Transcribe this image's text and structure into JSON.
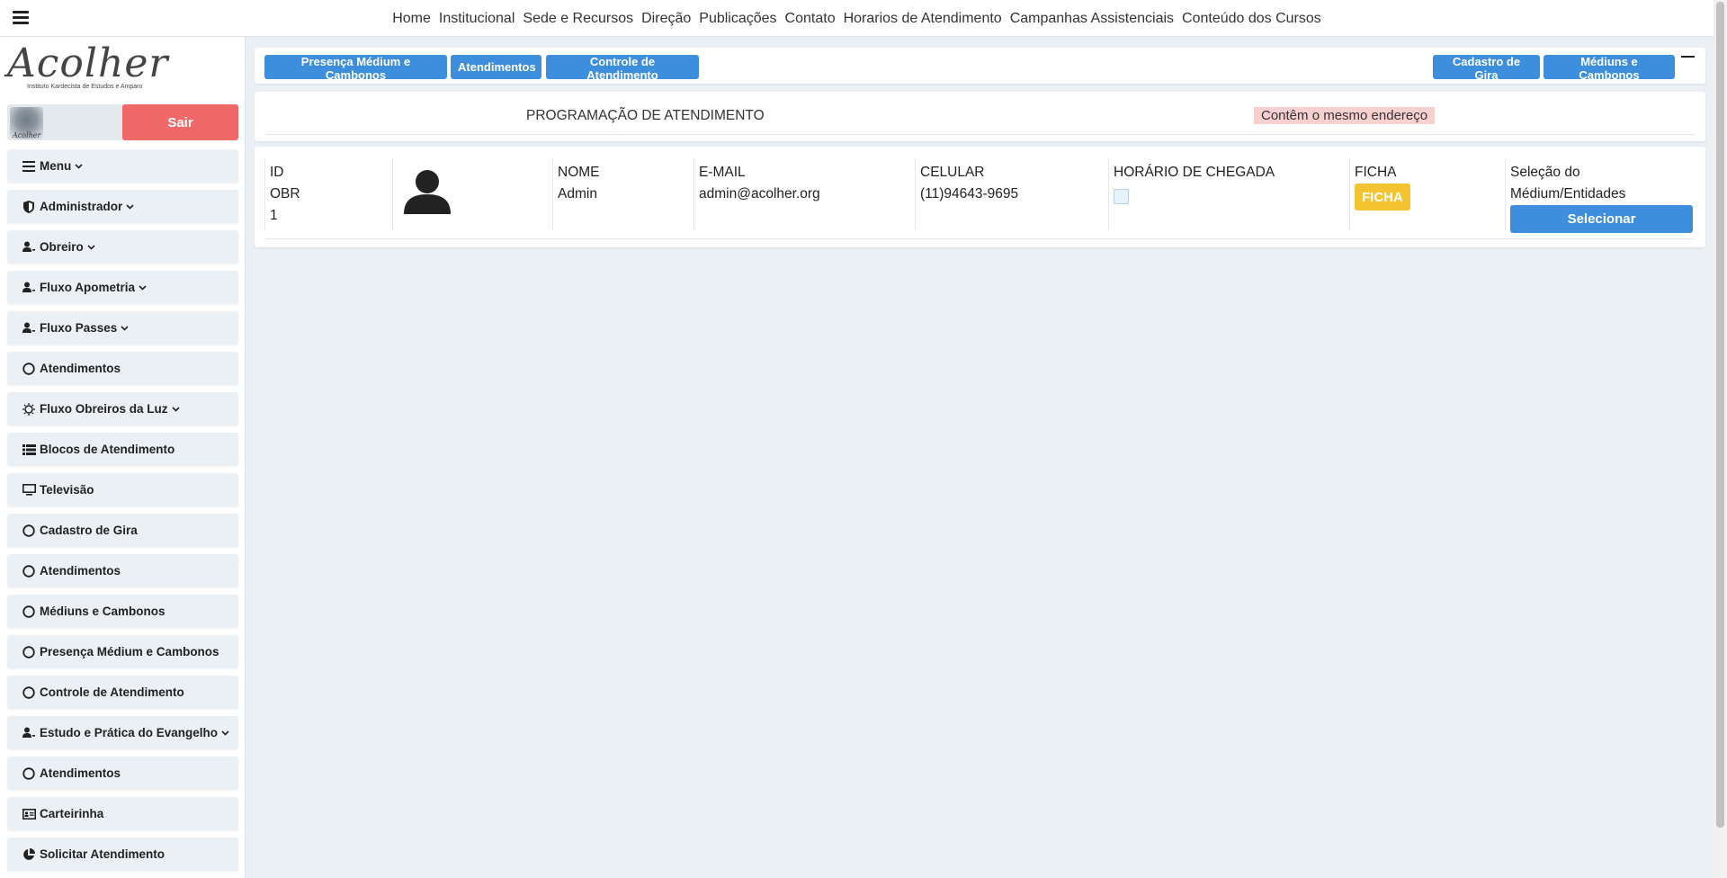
{
  "topnav": {
    "links": [
      "Home",
      "Institucional",
      "Sede e Recursos",
      "Direção",
      "Publicações",
      "Contato",
      "Horarios de Atendimento",
      "Campanhas Assistenciais",
      "Conteúdo dos Cursos"
    ]
  },
  "sidebar": {
    "logo_text": "Acolher",
    "logo_subtitle": "Instituto Kardecista de Estudos e Amparo",
    "avatar_label": "Acolher",
    "logout_label": "Sair",
    "items": [
      {
        "label": "Menu",
        "icon": "bars-icon",
        "chevron": true
      },
      {
        "label": "Administrador",
        "icon": "shield-icon",
        "chevron": true
      },
      {
        "label": "Obreiro",
        "icon": "user-gear-icon",
        "chevron": true
      },
      {
        "label": "Fluxo Apometria",
        "icon": "user-gear-icon",
        "chevron": true
      },
      {
        "label": "Fluxo Passes",
        "icon": "user-gear-icon",
        "chevron": true
      },
      {
        "label": "Atendimentos",
        "icon": "circle-icon",
        "chevron": false
      },
      {
        "label": "Fluxo Obreiros da Luz",
        "icon": "sun-icon",
        "chevron": true
      },
      {
        "label": "Blocos de Atendimento",
        "icon": "list-icon",
        "chevron": false
      },
      {
        "label": "Televisão",
        "icon": "tv-icon",
        "chevron": false
      },
      {
        "label": "Cadastro de Gira",
        "icon": "circle-icon",
        "chevron": false
      },
      {
        "label": "Atendimentos",
        "icon": "circle-icon",
        "chevron": false
      },
      {
        "label": "Médiuns e Cambonos",
        "icon": "circle-icon",
        "chevron": false
      },
      {
        "label": "Presença Médium e Cambonos",
        "icon": "circle-icon",
        "chevron": false
      },
      {
        "label": "Controle de Atendimento",
        "icon": "circle-icon",
        "chevron": false
      },
      {
        "label": "Estudo e Prática do Evangelho",
        "icon": "user-gear-icon",
        "chevron": true
      },
      {
        "label": "Atendimentos",
        "icon": "circle-icon",
        "chevron": false
      },
      {
        "label": "Carteirinha",
        "icon": "id-card-icon",
        "chevron": false
      },
      {
        "label": "Solicitar Atendimento",
        "icon": "chart-pie-icon",
        "chevron": false
      }
    ]
  },
  "toolbar": {
    "left_buttons": [
      "Presença Médium e Cambonos",
      "Atendimentos",
      "Controle de Atendimento"
    ],
    "right_buttons": [
      "Cadastro de Gira",
      "Médiuns e Cambonos"
    ]
  },
  "programacao": {
    "title": "PROGRAMAÇÃO DE ATENDIMENTO",
    "badge": "Contêm o mesmo endereço"
  },
  "table": {
    "id_header": "ID",
    "id_type": "OBR",
    "id_value": "1",
    "name_header": "NOME",
    "name_value": "Admin",
    "email_header": "E-MAIL",
    "email_value": "admin@acolher.org",
    "phone_header": "CELULAR",
    "phone_value": "(11)94643-9695",
    "arrival_header": "HORÁRIO DE CHEGADA",
    "ficha_header": "FICHA",
    "ficha_button": "FICHA",
    "selection_header": "Seleção do Médium/Entidades",
    "selection_button": "Selecionar"
  },
  "colors": {
    "primary": "#3e8ede",
    "danger": "#f06868",
    "warning": "#f4c430",
    "badge_bg": "#f9d0d0",
    "background": "#ebf0f5"
  }
}
